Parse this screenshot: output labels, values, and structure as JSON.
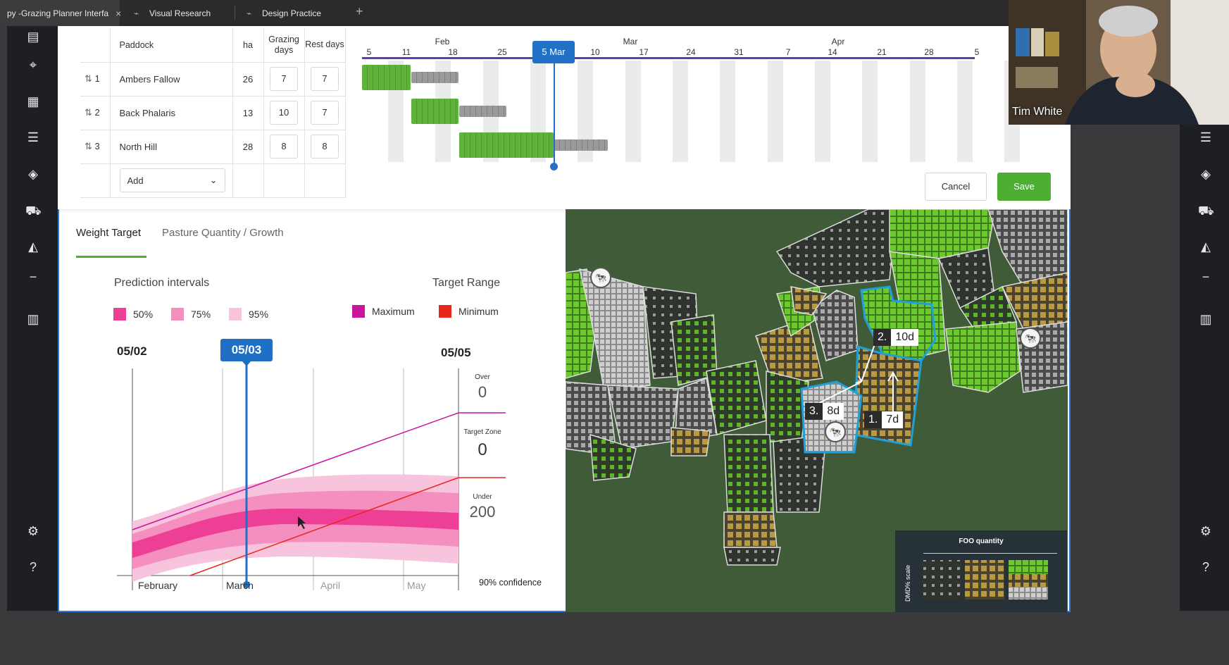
{
  "browser": {
    "tabs": [
      {
        "label": "py -Grazing Planner Interfa",
        "close": "×"
      },
      {
        "label": "Visual Research"
      },
      {
        "label": "Design Practice"
      }
    ],
    "new_tab": "+"
  },
  "planner": {
    "headers": {
      "paddock": "Paddock",
      "ha": "ha",
      "grazing": "Grazing days",
      "rest": "Rest days"
    },
    "rows": [
      {
        "index": "1",
        "name": "Ambers Fallow",
        "ha": "26",
        "grazing": "7",
        "rest": "7"
      },
      {
        "index": "2",
        "name": "Back Phalaris",
        "ha": "13",
        "grazing": "10",
        "rest": "7"
      },
      {
        "index": "3",
        "name": "North Hill",
        "ha": "28",
        "grazing": "8",
        "rest": "8"
      }
    ],
    "add_label": "Add",
    "cancel_label": "Cancel",
    "save_label": "Save",
    "today_badge": "5 Mar",
    "timeline_months": [
      {
        "label": "Feb"
      },
      {
        "label": "Mar"
      },
      {
        "label": "Apr"
      }
    ],
    "timeline_days": [
      "5",
      "11",
      "18",
      "25",
      "10",
      "17",
      "24",
      "31",
      "7",
      "14",
      "21",
      "28",
      "5"
    ]
  },
  "chart_panel": {
    "tabs": [
      "Weight Target",
      "Pasture Quantity / Growth"
    ],
    "prediction_title": "Prediction intervals",
    "target_title": "Target Range",
    "intervals": [
      {
        "label": "50%",
        "color": "#ee3f97"
      },
      {
        "label": "75%",
        "color": "#f58fc0"
      },
      {
        "label": "95%",
        "color": "#f8c3dd"
      }
    ],
    "targets": [
      {
        "label": "Maximum",
        "color": "#c8159a"
      },
      {
        "label": "Minimum",
        "color": "#e8261b"
      }
    ],
    "date_left": "05/02",
    "date_marker": "05/03",
    "date_right": "05/05",
    "over_label": "Over",
    "over_value": "0",
    "zone_label": "Target Zone",
    "zone_value": "0",
    "under_label": "Under",
    "under_value": "200",
    "confidence": "90% confidence",
    "months": [
      "February",
      "March",
      "April",
      "May"
    ]
  },
  "map": {
    "labels": [
      {
        "num": "2.",
        "days": "10d"
      },
      {
        "num": "3.",
        "days": "8d"
      },
      {
        "num": "1.",
        "days": "7d"
      }
    ],
    "legend_title": "FOO quantity",
    "legend_axis": "DMD% scale"
  },
  "webcam": {
    "name": "Tim White"
  }
}
